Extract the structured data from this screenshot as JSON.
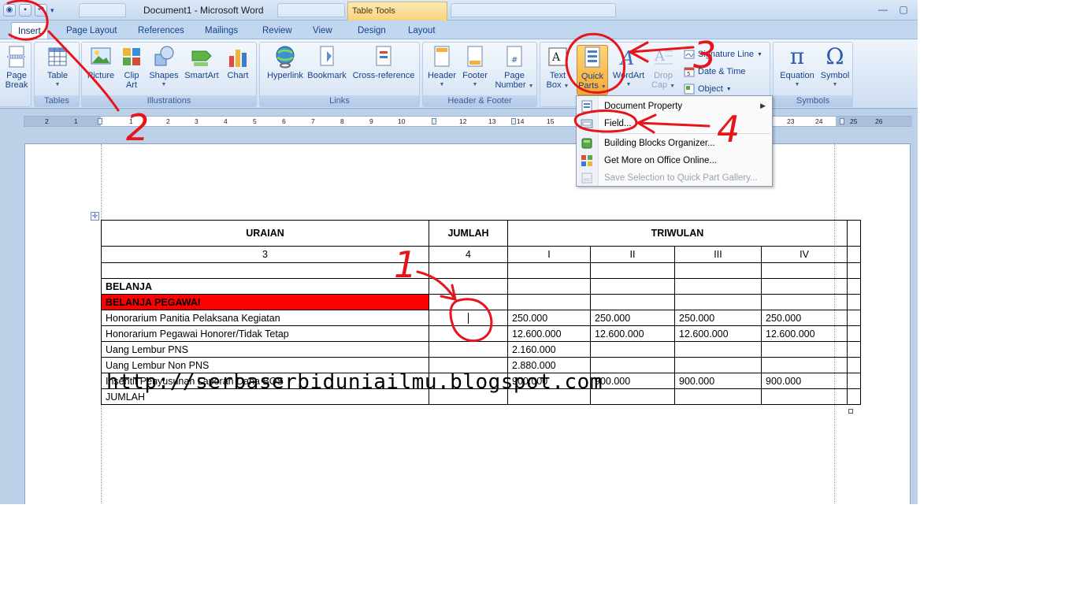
{
  "window": {
    "title": "Document1 - Microsoft Word",
    "contextual_tab": "Table Tools"
  },
  "tabs": [
    {
      "label": "Insert",
      "active": true
    },
    {
      "label": "Page Layout"
    },
    {
      "label": "References"
    },
    {
      "label": "Mailings"
    },
    {
      "label": "Review"
    },
    {
      "label": "View"
    },
    {
      "label": "Design"
    },
    {
      "label": "Layout"
    }
  ],
  "ribbon": {
    "groups": {
      "pages": "",
      "tables": "Tables",
      "illustrations": "Illustrations",
      "links": "Links",
      "header_footer": "Header & Footer",
      "text": "",
      "symbols": "Symbols"
    },
    "buttons": {
      "page_break_1": "Page",
      "page_break_2": "Break",
      "table": "Table",
      "picture": "Picture",
      "clip_art_1": "Clip",
      "clip_art_2": "Art",
      "shapes": "Shapes",
      "smartart": "SmartArt",
      "chart": "Chart",
      "hyperlink": "Hyperlink",
      "bookmark": "Bookmark",
      "cross_reference": "Cross-reference",
      "header": "Header",
      "footer": "Footer",
      "page_number_1": "Page",
      "page_number_2": "Number",
      "text_box_1": "Text",
      "text_box_2": "Box",
      "quick_parts_1": "Quick",
      "quick_parts_2": "Parts",
      "wordart": "WordArt",
      "drop_cap_1": "Drop",
      "drop_cap_2": "Cap",
      "signature_line": "Signature Line",
      "date_time": "Date & Time",
      "object": "Object",
      "equation": "Equation",
      "symbol": "Symbol"
    }
  },
  "ruler": {
    "numbers": [
      "2",
      "1",
      "1",
      "2",
      "3",
      "4",
      "5",
      "6",
      "7",
      "8",
      "9",
      "10",
      "12",
      "13",
      "14",
      "15",
      "23",
      "24",
      "25",
      "26"
    ]
  },
  "menu": {
    "items": [
      {
        "label": "Document Property",
        "has_submenu": true
      },
      {
        "label": "Field..."
      },
      {
        "label": "Building Blocks Organizer..."
      },
      {
        "label": "Get More on Office Online..."
      },
      {
        "label": "Save Selection to Quick Part Gallery...",
        "disabled": true
      }
    ]
  },
  "table": {
    "header": {
      "col1": "URAIAN",
      "col2": "JUMLAH",
      "col3": "TRIWULAN"
    },
    "numbering": [
      "3",
      "4",
      "I",
      "II",
      "III",
      "IV"
    ],
    "rows": [
      [
        "",
        "",
        "",
        "",
        "",
        ""
      ],
      [
        "BELANJA",
        "",
        "",
        "",
        "",
        ""
      ],
      [
        "BELANJA PEGAWAI",
        "",
        "",
        "",
        "",
        ""
      ],
      [
        "Honorarium Panitia Pelaksana Kegiatan",
        "",
        "250.000",
        "250.000",
        "250.000",
        "250.000"
      ],
      [
        "Honorarium Pegawai Honorer/Tidak Tetap",
        "",
        "12.600.000",
        "12.600.000",
        "12.600.000",
        "12.600.000"
      ],
      [
        "Uang Lembur PNS",
        "",
        "2.160.000",
        "",
        "",
        ""
      ],
      [
        "Uang Lembur Non PNS",
        "",
        "2.880.000",
        "",
        "",
        ""
      ],
      [
        "Insentif Penyusunan Laporan Dana BOS",
        "",
        "900.000",
        "900.000",
        "900.000",
        "900.000"
      ],
      [
        "JUMLAH",
        "",
        "",
        "",
        "",
        ""
      ]
    ]
  },
  "watermark": "http://serbaserbiduniailmu.blogspot.com",
  "annotations": [
    "1",
    "2",
    "3",
    "4"
  ],
  "colors": {
    "highlight_row": "#ff0000",
    "annotation": "#e8141c",
    "ribbon_bg": "#dbe7f6"
  }
}
